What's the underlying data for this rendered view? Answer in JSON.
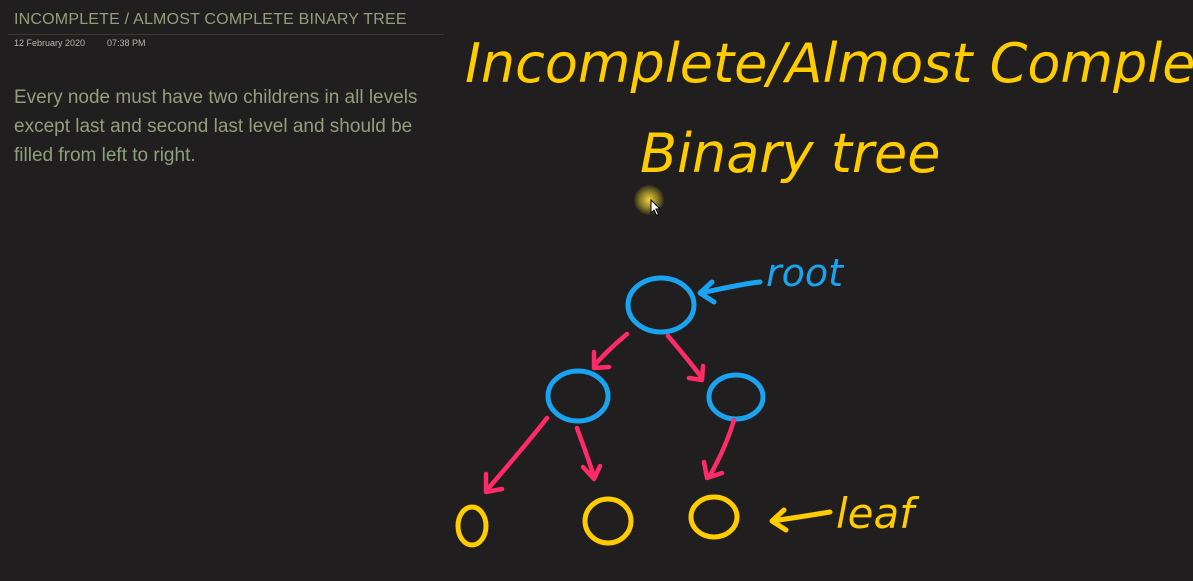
{
  "note": {
    "title": "INCOMPLETE / ALMOST COMPLETE BINARY TREE",
    "date": "12 February 2020",
    "time": "07:38 PM",
    "body": "Every node must have two childrens in all levels except last and second last level and should be filled from left to right."
  },
  "drawing": {
    "heading_line1": "Incomplete/Almost Complete",
    "heading_line2": "Binary tree",
    "root_label": "root",
    "leaf_label": "leaf"
  },
  "colors": {
    "background": "#201e1e",
    "note_text": "#8fa17a",
    "ink_yellow": "#ffcc00",
    "ink_blue": "#1aa3f0",
    "ink_pink": "#ff2b68"
  },
  "icons": {
    "pointer": "laser-pointer-icon"
  }
}
